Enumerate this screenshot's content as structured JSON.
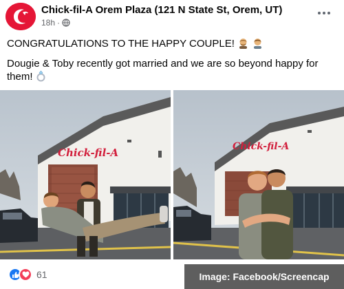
{
  "post": {
    "page_name": "Chick-fil-A Orem Plaza (121 N State St, Orem, UT)",
    "timestamp": "18h",
    "dot": "·",
    "audience_icon": "globe-icon",
    "more_icon": "more-horizontal-icon",
    "headline": "CONGRATULATIONS TO THE HAPPY COUPLE!",
    "headline_emojis": [
      "person-with-beard-emoji",
      "man-emoji"
    ],
    "body": "Dougie & Toby recently got married and we are so beyond happy for them!",
    "body_emoji": "ring-emoji"
  },
  "photos": [
    {
      "name": "photo-left",
      "sign_text": "Chick-fil-A",
      "description_icon": "couple-carry-photo"
    },
    {
      "name": "photo-right",
      "sign_text": "Chick-fil-A",
      "description_icon": "couple-hug-photo"
    }
  ],
  "footer": {
    "reaction_icons": [
      "like-icon",
      "love-icon"
    ],
    "reaction_count": "61",
    "credit": "Image: Facebook/Screencap"
  },
  "colors": {
    "brand_red": "#e51636",
    "like_blue": "#1877f2",
    "love_red": "#f33e58",
    "meta_gray": "#65676b",
    "credit_bg": "#5e5e5e"
  }
}
